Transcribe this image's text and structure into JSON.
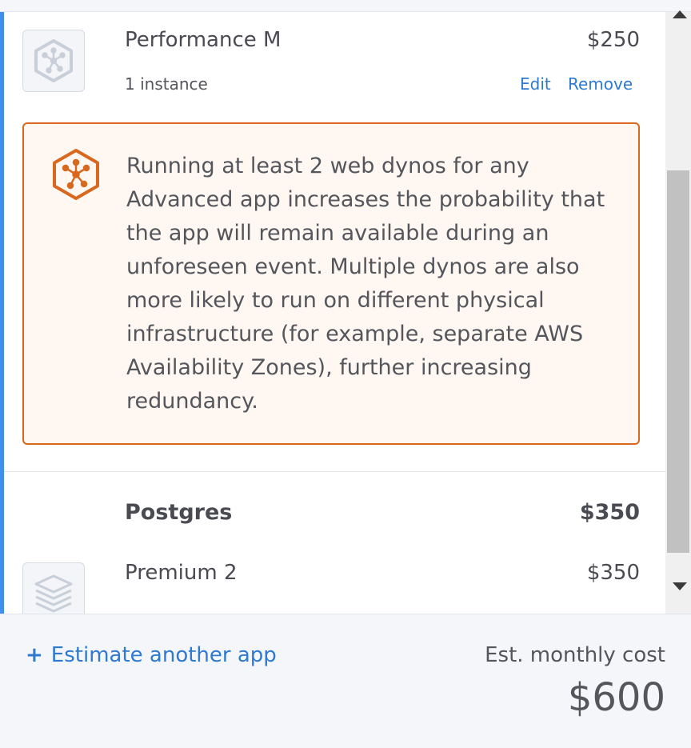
{
  "items": [
    {
      "name": "Performance M",
      "price": "$250",
      "instances": "1 instance",
      "edit_label": "Edit",
      "remove_label": "Remove",
      "icon": "dyno-hexagon-icon"
    }
  ],
  "alert": {
    "icon": "dyno-hexagon-icon",
    "message": "Running at least 2 web dynos for any Advanced app increases the probability that the app will remain available during an unforeseen event. Multiple dynos are also more likely to run on different physical infrastructure (for example, separate AWS Availability Zones), further increasing redundancy."
  },
  "addons": [
    {
      "category": "Postgres",
      "category_price": "$350",
      "plan": "Premium 2",
      "plan_price": "$350",
      "icon": "database-stack-icon"
    }
  ],
  "footer": {
    "estimate_link": "Estimate another app",
    "cost_label": "Est. monthly cost",
    "total": "$600"
  },
  "colors": {
    "accent": "#408fec",
    "link": "#2e7ad1",
    "warning_border": "#d8681e",
    "warning_bg": "#fef7f2"
  }
}
